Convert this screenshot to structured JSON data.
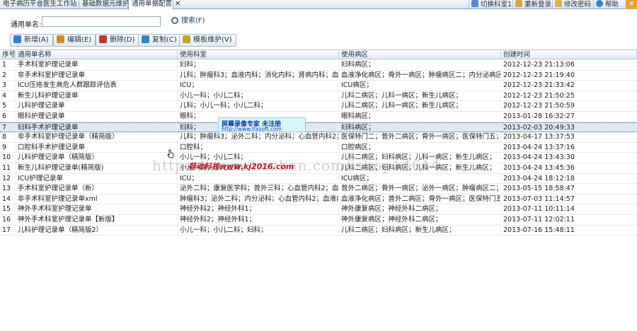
{
  "tabs": [
    {
      "label": "电子病历平台",
      "active": false
    },
    {
      "label": "医生工作站",
      "active": false
    },
    {
      "label": "基础数据元维护",
      "active": false
    },
    {
      "label": "通用单据配置",
      "active": true
    }
  ],
  "tab_close": "✕",
  "top_buttons": [
    {
      "label": "切换科室1",
      "icon": "switch-icon"
    },
    {
      "label": "重新登录",
      "icon": "relogin-icon"
    },
    {
      "label": "修改密码",
      "icon": "lock-icon"
    },
    {
      "label": "帮助",
      "icon": "help-icon"
    }
  ],
  "search": {
    "label": "通用单名:",
    "value": "",
    "button": "搜索(F)"
  },
  "toolbar": [
    {
      "label": "新增(A)",
      "icon": "add-icon",
      "color": "#3a7bd5"
    },
    {
      "label": "编辑(E)",
      "icon": "edit-icon",
      "color": "#d68a1e"
    },
    {
      "label": "删除(D)",
      "icon": "delete-icon",
      "color": "#c0392b"
    },
    {
      "label": "复制(C)",
      "icon": "copy-icon",
      "color": "#2e86c1"
    },
    {
      "label": "模板维护(V)",
      "icon": "template-icon",
      "color": "#c9a227"
    }
  ],
  "table": {
    "columns": [
      "序号",
      "通用单名称",
      "使用科室",
      "使用病区",
      "创建时间"
    ],
    "selected_row": 7,
    "rows": [
      [
        "1",
        "手术科室护理记录单",
        "妇科；",
        "妇科病区；",
        "2012-12-23 21:13:06"
      ],
      [
        "2",
        "非手术科室护理记录单",
        "儿科；肿瘤科3；血液内科；消化内科；肾病内科；血液净...",
        "血液净化病区；骨外一病区；肿瘤病区二；内分泌病区；",
        "2012-12-23 21:19:40"
      ],
      [
        "3",
        "ICU压疮发生高危人群跟踪评估表",
        "ICU；",
        "ICU病区；",
        "2012-12-23 21:33:42"
      ],
      [
        "4",
        "新生儿科护理记录单",
        "小儿一科；小儿二科；",
        "儿科二病区；儿科一病区；新生儿病区；",
        "2012-12-23 21:50:25"
      ],
      [
        "5",
        "儿科护理记录单",
        "儿科；小儿一科；小儿二科；",
        "儿科二病区；儿科一病区；新生儿病区；",
        "2012-12-23 21:50:59"
      ],
      [
        "6",
        "眼科护理记录单",
        "眼科；",
        "眼科病区；",
        "2013-01-28 16:32:27"
      ],
      [
        "7",
        "妇科手术护理记录单",
        "妇科；",
        "妇科病区；",
        "2013-02-03 20:49:33"
      ],
      [
        "8",
        "非手术科室护理记录单（精简版）",
        "儿科；肿瘤科3；泌外二科；内分泌科；心血管内科2；血...",
        "医保特门二；普外二病区；骨外一病区；医保特门五；肿...",
        "2013-04-17 13:37:53"
      ],
      [
        "9",
        "口腔科手术护理记录单",
        "口腔科；",
        "口腔病区；",
        "2013-04-24 13:37:16"
      ],
      [
        "10",
        "儿科护理记录单（精简版）",
        "小儿一科；小儿二科；",
        "儿科二病区；妇科病区；儿科一病区；新生儿病区；",
        "2013-04-24 13:43:30"
      ],
      [
        "11",
        "新生儿科护理记录单(精简版)",
        "小儿一科；小儿二科；",
        "儿科二病区；妇科病区；儿科一病区；新生儿病区；",
        "2013-04-24 13:45:36"
      ],
      [
        "12",
        "ICU护理记录单",
        "ICU；",
        "ICU病区；",
        "2013-04-24 18:12:18"
      ],
      [
        "13",
        "手术科室护理记录单（新）",
        "泌外二科；康复医学科；普外三科；心血管内科2；血液内...",
        "普外二病区；骨外一病区；泌外一病区；肿瘤病区二；内...",
        "2013-05-15 18:58:47"
      ],
      [
        "14",
        "非手术科室护理记录单xml",
        "肿瘤科3；泌外二科；内分泌科；心血管内科2；血液内科...",
        "血液净化病区；普外二病区；骨外一病区；医保特门五；肿...",
        "2013-07-03 11:14:57"
      ],
      [
        "15",
        "神外手术科室护理记录单",
        "神经外科2；神经外科1；",
        "神外康复病区；神经外科二病区；",
        "2013-07-11 10:11:14"
      ],
      [
        "16",
        "神外手术科室护理记录单【新版】",
        "神经外科2；神经外科1；",
        "神外康复病区；神经外科二病区；",
        "2013-07-11 12:02:11"
      ],
      [
        "17",
        "儿科护理记录单（精简版2）",
        "小儿一科；小儿二科；妇科；",
        "儿科二病区；妇科病区；新生儿病区；",
        "2013-07-16 15:48:11"
      ]
    ]
  },
  "watermark": {
    "box_title": "屏幕录像专家      未注册",
    "box_url": "http://www.tlxsoft.com",
    "overlay_url": "https://www.huzhan.com/ishop14614",
    "overlay_red": "荷动科技www.kj2016.com"
  }
}
